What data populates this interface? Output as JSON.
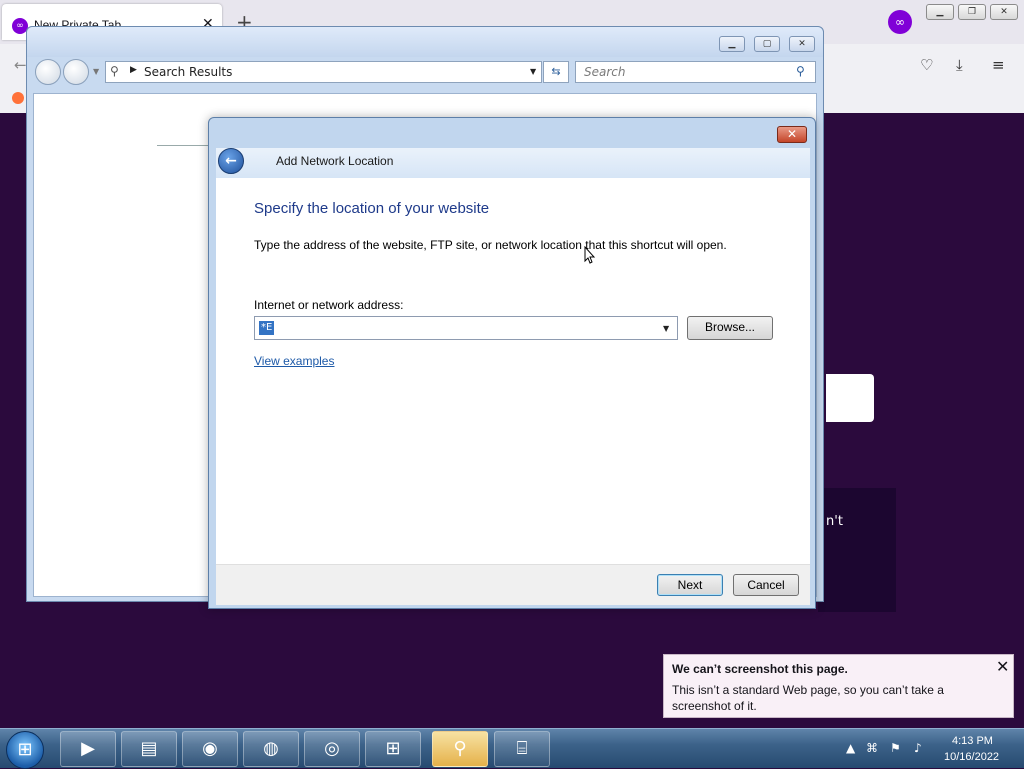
{
  "firefox": {
    "tab_title": "New Private Tab",
    "tab_close": "✕",
    "new_tab": "+",
    "private_badge": "∞",
    "partial_text": "n't"
  },
  "explorer": {
    "address": "Search Results",
    "search_placeholder": "Search"
  },
  "wizard": {
    "title": "Add Network Location",
    "heading": "Specify the location of your website",
    "description": "Type the address of the website, FTP site, or network location that this shortcut will open.",
    "address_label": "Internet or network address:",
    "address_value": "*E",
    "browse_label": "Browse...",
    "view_examples": "View examples",
    "next_label": "Next",
    "cancel_label": "Cancel"
  },
  "notification": {
    "title": "We can’t screenshot this page.",
    "message": "This isn’t a standard Web page, so you can’t take a screenshot of it."
  },
  "taskbar": {
    "items": [
      "media-player",
      "file-explorer",
      "avast",
      "firefox",
      "chrome",
      "windows-update",
      "magnifier",
      "network-app"
    ],
    "time": "4:13 PM",
    "date": "10/16/2022"
  }
}
